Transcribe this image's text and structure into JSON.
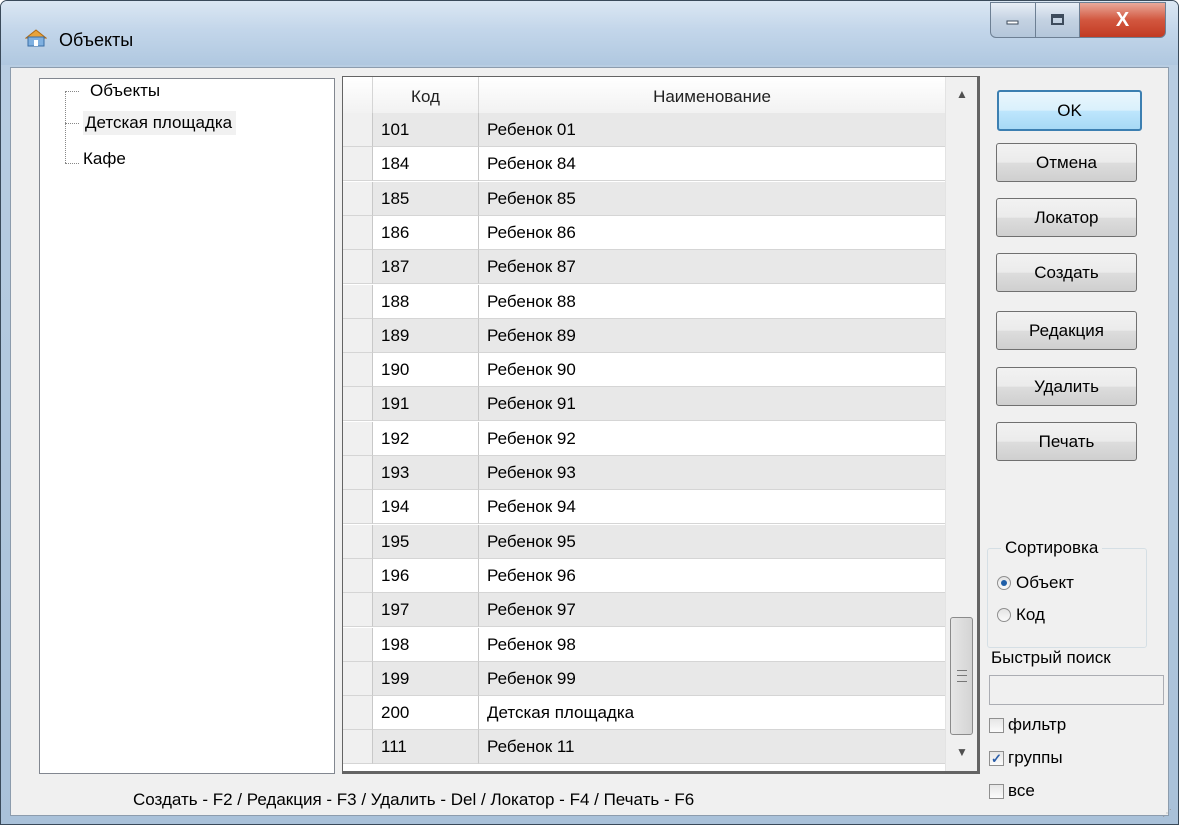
{
  "window": {
    "title": "Объекты",
    "icon": "home-folder-icon",
    "controls": {
      "minimize_icon": "minimize-icon",
      "maximize_icon": "maximize-icon",
      "close_label": "X"
    }
  },
  "tree": {
    "items": [
      {
        "label": "Объекты",
        "selected": false
      },
      {
        "label": "Детская площадка",
        "selected": true
      },
      {
        "label": "Кафе",
        "selected": false
      }
    ]
  },
  "grid": {
    "columns": [
      "Код",
      "Наименование"
    ],
    "rows": [
      {
        "code": "101",
        "name": "Ребенок 01"
      },
      {
        "code": "184",
        "name": "Ребенок 84"
      },
      {
        "code": "185",
        "name": "Ребенок 85"
      },
      {
        "code": "186",
        "name": "Ребенок 86"
      },
      {
        "code": "187",
        "name": "Ребенок 87"
      },
      {
        "code": "188",
        "name": "Ребенок 88"
      },
      {
        "code": "189",
        "name": "Ребенок 89"
      },
      {
        "code": "190",
        "name": "Ребенок 90"
      },
      {
        "code": "191",
        "name": "Ребенок 91"
      },
      {
        "code": "192",
        "name": "Ребенок 92"
      },
      {
        "code": "193",
        "name": "Ребенок 93"
      },
      {
        "code": "194",
        "name": "Ребенок 94"
      },
      {
        "code": "195",
        "name": "Ребенок 95"
      },
      {
        "code": "196",
        "name": "Ребенок 96"
      },
      {
        "code": "197",
        "name": "Ребенок 97"
      },
      {
        "code": "198",
        "name": "Ребенок 98"
      },
      {
        "code": "199",
        "name": "Ребенок 99"
      },
      {
        "code": "200",
        "name": "Детская площадка"
      },
      {
        "code": "111",
        "name": "Ребенок 11"
      }
    ]
  },
  "buttons": {
    "ok": "OK",
    "cancel": "Отмена",
    "locator": "Локатор",
    "create": "Создать",
    "edit": "Редакция",
    "delete": "Удалить",
    "print": "Печать"
  },
  "sort": {
    "title": "Сортировка",
    "options": [
      {
        "label": "Объект",
        "selected": true
      },
      {
        "label": "Код",
        "selected": false
      }
    ]
  },
  "search": {
    "label": "Быстрый поиск",
    "value": ""
  },
  "checkboxes": [
    {
      "label": "фильтр",
      "checked": false
    },
    {
      "label": "группы",
      "checked": true
    },
    {
      "label": "все",
      "checked": false
    }
  ],
  "status": "Создать - F2 / Редакция - F3 / Удалить - Del / Локатор - F4 / Печать - F6",
  "colors": {
    "accent": "#3c7fb1",
    "row_alt": "#e8e8e8",
    "close_red": "#c23a22"
  }
}
